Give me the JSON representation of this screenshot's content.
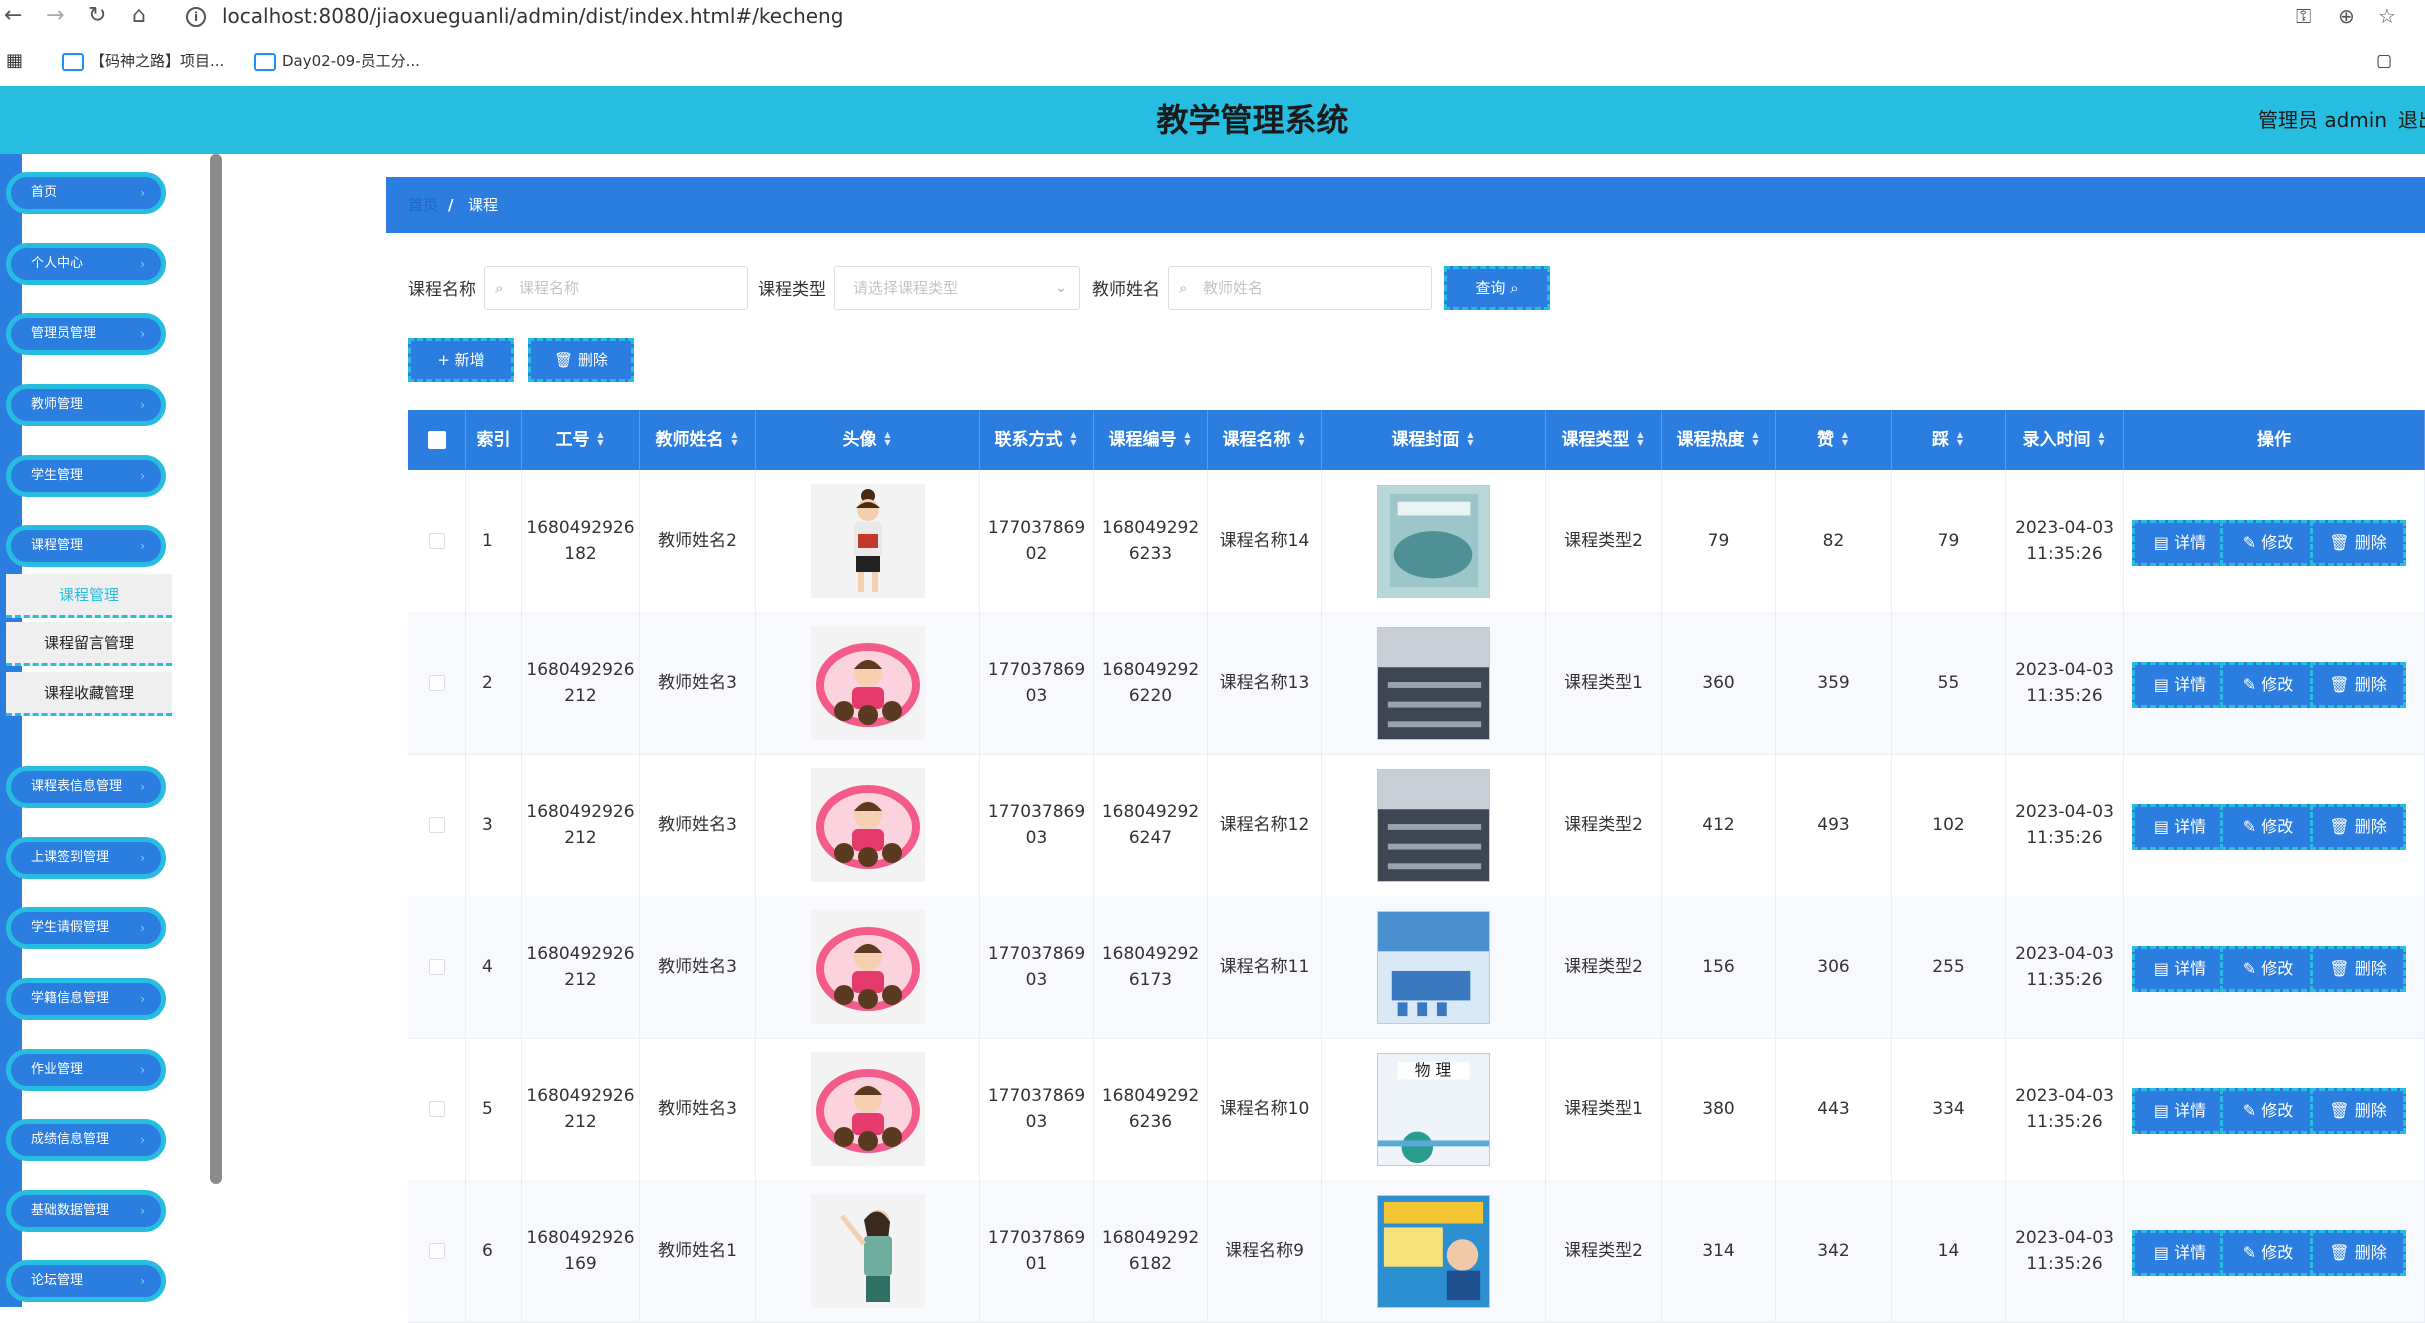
{
  "browser": {
    "url": "localhost:8080/jiaoxueguanli/admin/dist/index.html#/kecheng",
    "bookmarks": [
      "【码神之路】项目...",
      "Day02-09-员工分..."
    ]
  },
  "header": {
    "title": "教学管理系统",
    "user": "管理员 admin",
    "logout": "退出登录"
  },
  "sidebar": {
    "items": [
      {
        "label": "首页"
      },
      {
        "label": "个人中心"
      },
      {
        "label": "管理员管理"
      },
      {
        "label": "教师管理"
      },
      {
        "label": "学生管理"
      },
      {
        "label": "课程管理"
      },
      {
        "label": "课程表信息管理"
      },
      {
        "label": "上课签到管理"
      },
      {
        "label": "学生请假管理"
      },
      {
        "label": "学籍信息管理"
      },
      {
        "label": "作业管理"
      },
      {
        "label": "成绩信息管理"
      },
      {
        "label": "基础数据管理"
      },
      {
        "label": "论坛管理"
      }
    ],
    "submenu": [
      "课程管理",
      "课程留言管理",
      "课程收藏管理"
    ]
  },
  "breadcrumb": {
    "home": "首页",
    "current": "课程"
  },
  "search": {
    "name_label": "课程名称",
    "name_placeholder": "课程名称",
    "type_label": "课程类型",
    "type_placeholder": "请选择课程类型",
    "teacher_label": "教师姓名",
    "teacher_placeholder": "教师姓名",
    "query_button": "查询"
  },
  "toolbar": {
    "add": "+ 新增",
    "delete": "删除"
  },
  "table": {
    "columns": [
      "索引",
      "工号",
      "教师姓名",
      "头像",
      "联系方式",
      "课程编号",
      "课程名称",
      "课程封面",
      "课程类型",
      "课程热度",
      "赞",
      "踩",
      "录入时间",
      "操作"
    ],
    "ops": [
      "详情",
      "修改",
      "删除"
    ],
    "rows": [
      {
        "idx": "1",
        "gonghao": [
          "1680492926",
          "182"
        ],
        "teacher": "教师姓名2",
        "phone": [
          "177037869",
          "02"
        ],
        "code": [
          "168049292",
          "6233"
        ],
        "course": "课程名称14",
        "type": "课程类型2",
        "heat": "79",
        "zan": "82",
        "cai": "79",
        "time": [
          "2023-04-03",
          "11:35:26"
        ],
        "avatar": "teacher2",
        "cover": "book"
      },
      {
        "idx": "2",
        "gonghao": [
          "1680492926",
          "212"
        ],
        "teacher": "教师姓名3",
        "phone": [
          "177037869",
          "03"
        ],
        "code": [
          "168049292",
          "6220"
        ],
        "course": "课程名称13",
        "type": "课程类型1",
        "heat": "360",
        "zan": "359",
        "cai": "55",
        "time": [
          "2023-04-03",
          "11:35:26"
        ],
        "avatar": "teacher3",
        "cover": "classroom"
      },
      {
        "idx": "3",
        "gonghao": [
          "1680492926",
          "212"
        ],
        "teacher": "教师姓名3",
        "phone": [
          "177037869",
          "03"
        ],
        "code": [
          "168049292",
          "6247"
        ],
        "course": "课程名称12",
        "type": "课程类型2",
        "heat": "412",
        "zan": "493",
        "cai": "102",
        "time": [
          "2023-04-03",
          "11:35:26"
        ],
        "avatar": "teacher3",
        "cover": "classroom"
      },
      {
        "idx": "4",
        "gonghao": [
          "1680492926",
          "212"
        ],
        "teacher": "教师姓名3",
        "phone": [
          "177037869",
          "03"
        ],
        "code": [
          "168049292",
          "6173"
        ],
        "course": "课程名称11",
        "type": "课程类型2",
        "heat": "156",
        "zan": "306",
        "cai": "255",
        "time": [
          "2023-04-03",
          "11:35:26"
        ],
        "avatar": "teacher3",
        "cover": "slide"
      },
      {
        "idx": "5",
        "gonghao": [
          "1680492926",
          "212"
        ],
        "teacher": "教师姓名3",
        "phone": [
          "177037869",
          "03"
        ],
        "code": [
          "168049292",
          "6236"
        ],
        "course": "课程名称10",
        "type": "课程类型1",
        "heat": "380",
        "zan": "443",
        "cai": "334",
        "time": [
          "2023-04-03",
          "11:35:26"
        ],
        "avatar": "teacher3",
        "cover": "physics"
      },
      {
        "idx": "6",
        "gonghao": [
          "1680492926",
          "169"
        ],
        "teacher": "教师姓名1",
        "phone": [
          "177037869",
          "01"
        ],
        "code": [
          "168049292",
          "6182"
        ],
        "course": "课程名称9",
        "type": "课程类型2",
        "heat": "314",
        "zan": "342",
        "cai": "14",
        "time": [
          "2023-04-03",
          "11:35:26"
        ],
        "avatar": "teacher1",
        "cover": "poster"
      }
    ]
  },
  "colors": {
    "primary": "#2b7de0",
    "accent": "#27bde0"
  }
}
